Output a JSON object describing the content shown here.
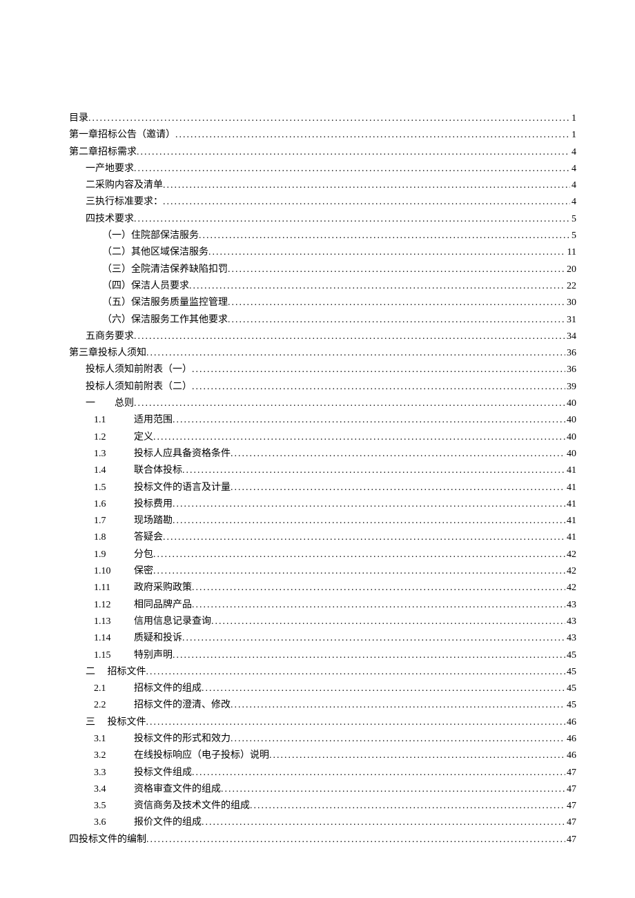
{
  "toc": [
    {
      "indent": "indent-0",
      "num": "",
      "label": "目录",
      "page": "1"
    },
    {
      "indent": "indent-0",
      "num": "",
      "label": "第一章招标公告（邀请）",
      "page": "1"
    },
    {
      "indent": "indent-0",
      "num": "",
      "label": "第二章招标需求",
      "page": "4"
    },
    {
      "indent": "indent-1",
      "num": "",
      "label": "一产地要求",
      "page": "4"
    },
    {
      "indent": "indent-1",
      "num": "",
      "label": "二采购内容及清单",
      "page": "4"
    },
    {
      "indent": "indent-1",
      "num": "",
      "label": "三执行标准要求：",
      "page": "4"
    },
    {
      "indent": "indent-1",
      "num": "",
      "label": "四技术要求",
      "page": "5"
    },
    {
      "indent": "indent-2",
      "num": "",
      "label": "（一）住院部保洁服务",
      "page": "5"
    },
    {
      "indent": "indent-2",
      "num": "",
      "label": "（二）其他区域保洁服务",
      "page": "11"
    },
    {
      "indent": "indent-2",
      "num": "",
      "label": "（三）全院清洁保养缺陷扣罚",
      "page": "20"
    },
    {
      "indent": "indent-2",
      "num": "",
      "label": "（四）保洁人员要求",
      "page": "22"
    },
    {
      "indent": "indent-2",
      "num": "",
      "label": "（五）保洁服务质量监控管理",
      "page": "30"
    },
    {
      "indent": "indent-2",
      "num": "",
      "label": "（六）保洁服务工作其他要求",
      "page": "31"
    },
    {
      "indent": "indent-1",
      "num": "",
      "label": "五商务要求",
      "page": "34"
    },
    {
      "indent": "indent-0",
      "num": "",
      "label": "第三章投标人须知",
      "page": "36"
    },
    {
      "indent": "indent-1",
      "num": "",
      "label": "投标人须知前附表（一）",
      "page": "36"
    },
    {
      "indent": "indent-1",
      "num": "",
      "label": "投标人须知前附表（二）",
      "page": "39"
    },
    {
      "indent": "indent-1",
      "num": "",
      "label": "一　　总则",
      "page": "40"
    },
    {
      "indent": "indent-num",
      "num": "1.1",
      "label": "适用范围",
      "page": "40"
    },
    {
      "indent": "indent-num",
      "num": "1.2",
      "label": "定义",
      "page": "40"
    },
    {
      "indent": "indent-num",
      "num": "1.3",
      "label": "投标人应具备资格条件",
      "page": "40"
    },
    {
      "indent": "indent-num",
      "num": "1.4",
      "label": "联合体投标",
      "page": "41"
    },
    {
      "indent": "indent-num",
      "num": "1.5",
      "label": "投标文件的语言及计量",
      "page": "41"
    },
    {
      "indent": "indent-num",
      "num": "1.6",
      "label": "投标费用",
      "page": "41"
    },
    {
      "indent": "indent-num",
      "num": "1.7",
      "label": "现场踏勘",
      "page": "41"
    },
    {
      "indent": "indent-num",
      "num": "1.8",
      "label": "答疑会",
      "page": "41"
    },
    {
      "indent": "indent-num",
      "num": "1.9",
      "label": "分包",
      "page": "42"
    },
    {
      "indent": "indent-num",
      "num": "1.10",
      "label": "保密",
      "page": "42"
    },
    {
      "indent": "indent-num",
      "num": "1.11",
      "label": "政府采购政策",
      "page": "42"
    },
    {
      "indent": "indent-num",
      "num": "1.12",
      "label": "相同品牌产品",
      "page": "43"
    },
    {
      "indent": "indent-num",
      "num": "1.13",
      "label": "信用信息记录查询",
      "page": "43"
    },
    {
      "indent": "indent-num",
      "num": "1.14",
      "label": "质疑和投诉",
      "page": "43"
    },
    {
      "indent": "indent-num",
      "num": "1.15",
      "label": "特别声明",
      "page": "45"
    },
    {
      "indent": "indent-1",
      "num": "",
      "label": "二　 招标文件",
      "page": "45"
    },
    {
      "indent": "indent-num",
      "num": "2.1",
      "label": "招标文件的组成",
      "page": "45"
    },
    {
      "indent": "indent-num",
      "num": "2.2",
      "label": "招标文件的澄清、修改",
      "page": "45"
    },
    {
      "indent": "indent-1",
      "num": "",
      "label": "三　 投标文件",
      "page": "46"
    },
    {
      "indent": "indent-num",
      "num": "3.1",
      "label": "投标文件的形式和效力",
      "page": "46"
    },
    {
      "indent": "indent-num",
      "num": "3.2",
      "label": "在线投标响应（电子投标）说明",
      "page": "46"
    },
    {
      "indent": "indent-num",
      "num": "3.3",
      "label": "投标文件组成",
      "page": "47"
    },
    {
      "indent": "indent-num",
      "num": "3.4",
      "label": "资格审查文件的组成",
      "page": "47"
    },
    {
      "indent": "indent-num",
      "num": "3.5",
      "label": "资信商务及技术文件的组成",
      "page": "47"
    },
    {
      "indent": "indent-num",
      "num": "3.6",
      "label": "报价文件的组成",
      "page": "47"
    },
    {
      "indent": "indent-0",
      "num": "",
      "label": "四投标文件的编制 ",
      "page": "47"
    }
  ]
}
